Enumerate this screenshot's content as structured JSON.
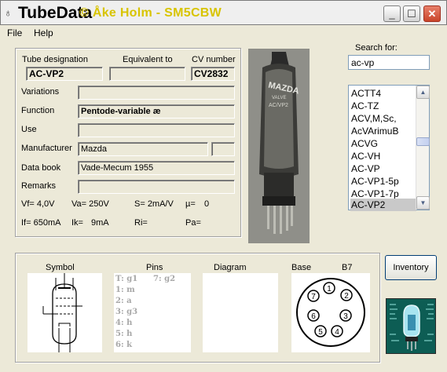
{
  "window": {
    "title": "TubeData",
    "credit": "© Åke Holm - SM5CBW",
    "icon": "tube-icon"
  },
  "menu": {
    "items": [
      {
        "label": "File",
        "accel": "F"
      },
      {
        "label": "Help",
        "accel": "H"
      }
    ]
  },
  "tube": {
    "designation_label": "Tube designation",
    "designation": "AC-VP2",
    "equivalent_label": "Equivalent to",
    "equivalent": "",
    "cv_label": "CV number",
    "cv": "CV2832",
    "variations_label": "Variations",
    "variations": "",
    "function_label": "Function",
    "function": "Pentode-variable æ",
    "use_label": "Use",
    "use": "",
    "manufacturer_label": "Manufacturer",
    "manufacturer": "Mazda",
    "manufacturer_extra": "",
    "databook_label": "Data book",
    "databook": "Vade-Mecum 1955",
    "remarks_label": "Remarks",
    "remarks": ""
  },
  "specs": {
    "vf": "Vf= 4,0V",
    "va": "Va= 250V",
    "s": "S= 2mA/V",
    "mu": "µ=",
    "mu_value": "0",
    "if": "If= 650mA",
    "ik": "Ik=",
    "ik_value": "9mA",
    "ri": "Ri=",
    "pa": "Pa="
  },
  "search": {
    "label": "Search for:",
    "value": "ac-vp"
  },
  "list": {
    "items": [
      "ACTT4",
      "AC-TZ",
      "ACV,M,Sc,",
      "AcVArimuB",
      "ACVG",
      "AC-VH",
      "AC-VP",
      "AC-VP1-5p",
      "AC-VP1-7p",
      "AC-VP2"
    ],
    "selected": "AC-VP2"
  },
  "bottom": {
    "symbol_label": "Symbol",
    "pins_label": "Pins",
    "diagram_label": "Diagram",
    "base_label": "Base",
    "base_value": "B7",
    "pins": [
      "T: g1",
      "7: g2",
      "1: m",
      "2: a",
      "3: g3",
      "4: h",
      "5: h",
      "6: k"
    ],
    "base_pins": [
      "1",
      "2",
      "3",
      "4",
      "5",
      "6",
      "7"
    ]
  },
  "buttons": {
    "inventory": "Inventory"
  },
  "photo": {
    "brand": "MAZDA",
    "sub": "VALVE",
    "type": "AC/VP2"
  },
  "colors": {
    "window_bg": "#ece9d8",
    "credit": "#d8c400",
    "close_button": "#c9452a",
    "logo_bg": "#0d5d54",
    "selection": "#c9c9c9"
  }
}
